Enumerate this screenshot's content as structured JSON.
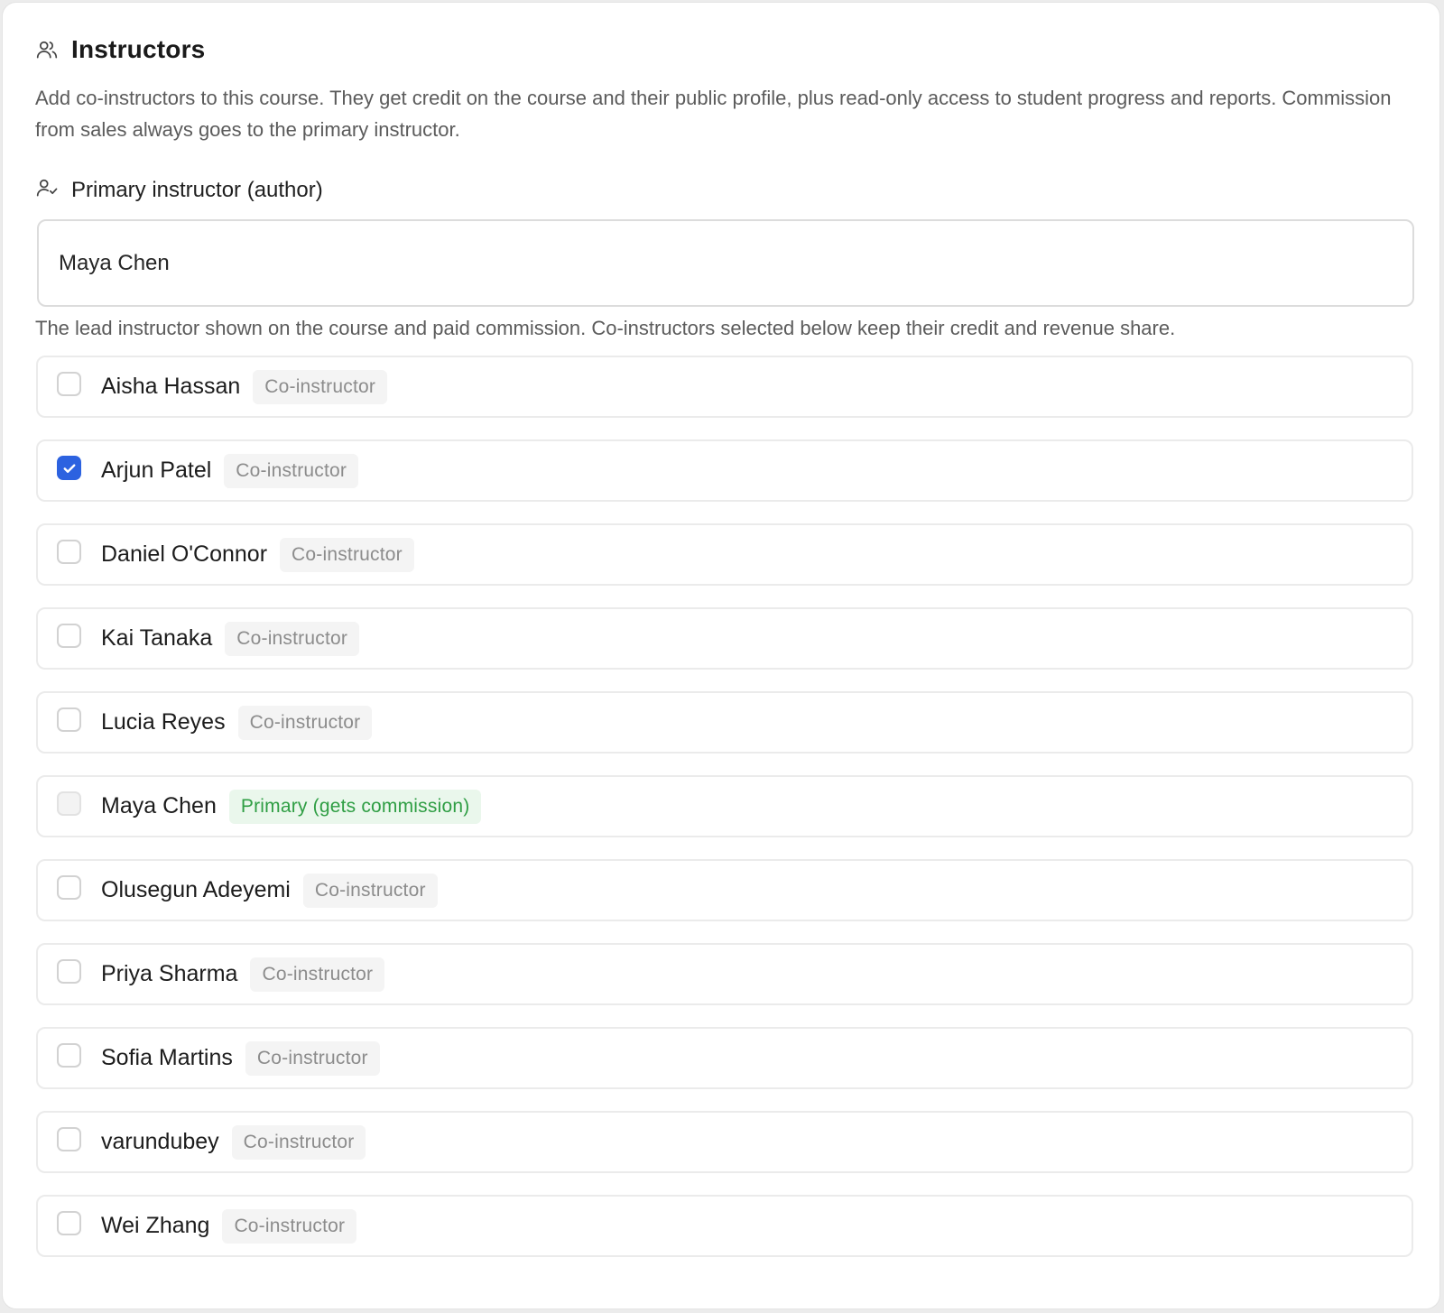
{
  "section": {
    "title": "Instructors",
    "icon": "users-icon",
    "description": "Add co-instructors to this course. They get credit on the course and their public profile, plus read-only access to student progress and reports. Commission from sales always goes to the primary instructor."
  },
  "primary_field": {
    "label": "Primary instructor (author)",
    "icon": "user-check-icon",
    "value": "Maya Chen",
    "help": "The lead instructor shown on the course and paid commission. Co-instructors selected below keep their credit and revenue share."
  },
  "colors": {
    "accent": "#2c62e0",
    "primary_badge_text": "#2f9e44",
    "primary_badge_bg": "#eaf7ec"
  },
  "instructors": [
    {
      "name": "Aisha Hassan",
      "badge": "Co-instructor",
      "checked": false,
      "primary": false
    },
    {
      "name": "Arjun Patel",
      "badge": "Co-instructor",
      "checked": true,
      "primary": false
    },
    {
      "name": "Daniel O'Connor",
      "badge": "Co-instructor",
      "checked": false,
      "primary": false
    },
    {
      "name": "Kai Tanaka",
      "badge": "Co-instructor",
      "checked": false,
      "primary": false
    },
    {
      "name": "Lucia Reyes",
      "badge": "Co-instructor",
      "checked": false,
      "primary": false
    },
    {
      "name": "Maya Chen",
      "badge": "Primary (gets commission)",
      "checked": false,
      "primary": true
    },
    {
      "name": "Olusegun Adeyemi",
      "badge": "Co-instructor",
      "checked": false,
      "primary": false
    },
    {
      "name": "Priya Sharma",
      "badge": "Co-instructor",
      "checked": false,
      "primary": false
    },
    {
      "name": "Sofia Martins",
      "badge": "Co-instructor",
      "checked": false,
      "primary": false
    },
    {
      "name": "varundubey",
      "badge": "Co-instructor",
      "checked": false,
      "primary": false
    },
    {
      "name": "Wei Zhang",
      "badge": "Co-instructor",
      "checked": false,
      "primary": false
    }
  ]
}
